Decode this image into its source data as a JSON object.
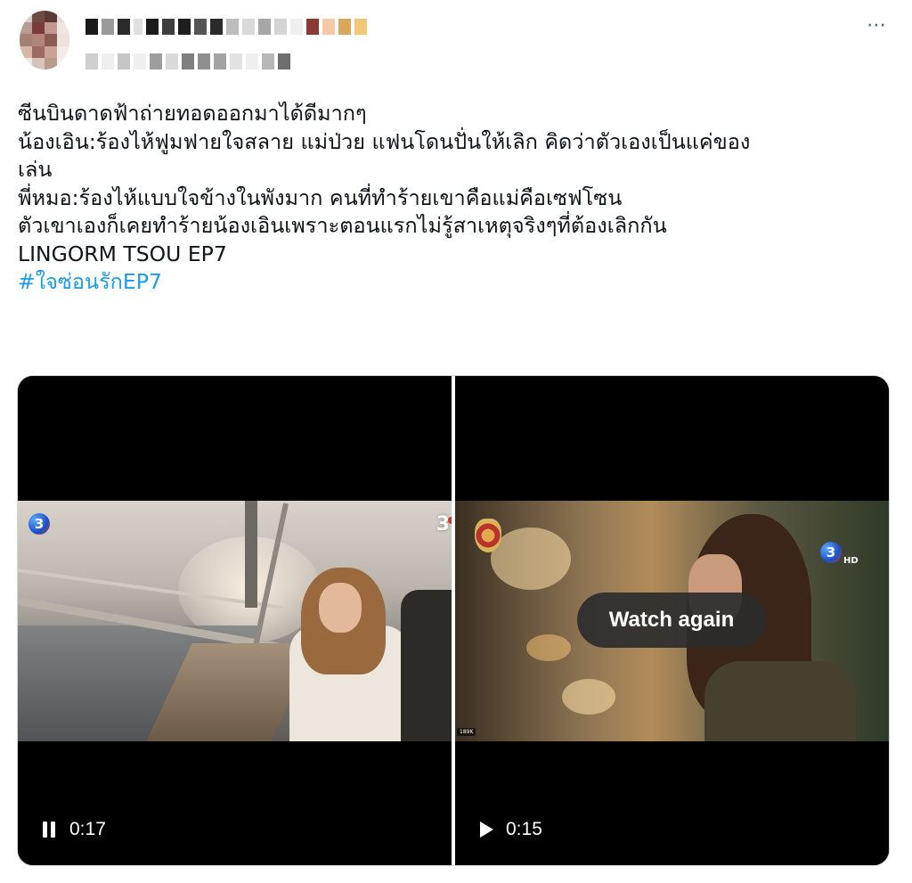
{
  "tweet": {
    "author_name_obscured": true,
    "more_icon": "⋯",
    "text_lines": [
      "ซีนบินดาดฟ้าถ่ายทอดออกมาได้ดีมากๆ",
      "น้องเอิน:ร้องไห้ฟูมฟายใจสลาย แม่ป่วย แฟนโดนปั่นให้เลิก คิดว่าตัวเองเป็นแค่ของ",
      "เล่น",
      "พี่หมอ:ร้องไห้แบบใจข้างในพังมาก คนที่ทำร้ายเขาคือแม่คือเซฟโซน",
      "ตัวเขาเองก็เคยทำร้ายน้องเอินเพราะตอนแรกไม่รู้สาเหตุจริงๆที่ต้องเลิกกัน",
      "LINGORM TSOU EP7"
    ],
    "hashtag": "#ใจซ่อนรักEP7"
  },
  "media": {
    "left_video": {
      "state": "playing",
      "control_icon": "pause-icon",
      "time": "0:17",
      "channel_logo_left": "3",
      "channel_logo_right": "3"
    },
    "right_video": {
      "state": "ended",
      "control_icon": "play-icon",
      "time": "0:15",
      "overlay_button": "Watch again",
      "channel_logo": "3",
      "channel_suffix": "HD",
      "corner_chip": "189K"
    }
  }
}
